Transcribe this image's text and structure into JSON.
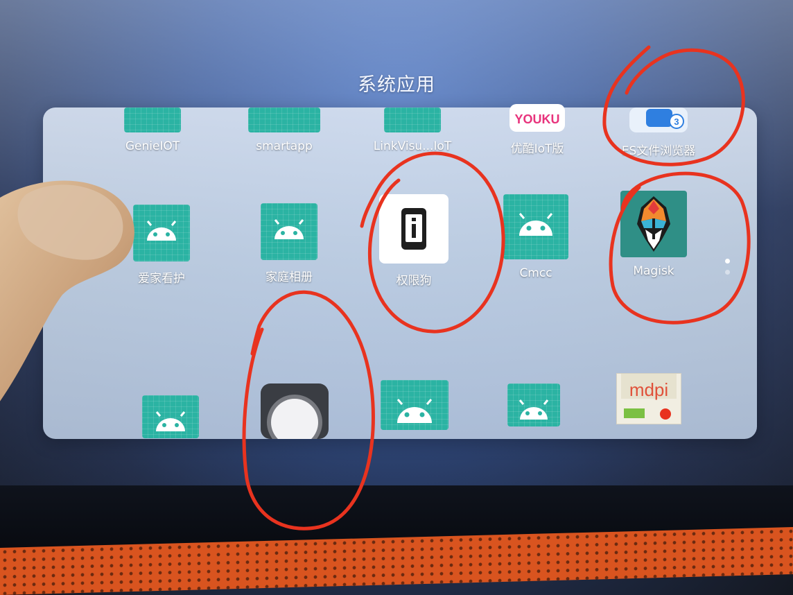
{
  "folder": {
    "title": "系统应用"
  },
  "apps": [
    {
      "label": "GenieIOT",
      "icon": "android-icon"
    },
    {
      "label": "smartapp",
      "icon": "android-icon"
    },
    {
      "label": "LinkVisu...IoT",
      "icon": "android-icon"
    },
    {
      "label": "优酷IoT版",
      "icon": "youku-icon",
      "icon_text": "YOUKU"
    },
    {
      "label": "ES文件浏览器",
      "icon": "es-file-explorer-icon",
      "icon_text": "3"
    },
    {
      "label": "爱家看护",
      "icon": "android-icon"
    },
    {
      "label": "家庭相册",
      "icon": "android-icon"
    },
    {
      "label": "权限狗",
      "icon": "info-phone-icon"
    },
    {
      "label": "Cmcc",
      "icon": "android-icon"
    },
    {
      "label": "Magisk",
      "icon": "magisk-icon"
    },
    {
      "label": "",
      "icon": "android-icon"
    },
    {
      "label": "",
      "icon": "assistive-touch-icon"
    },
    {
      "label": "",
      "icon": "android-icon"
    },
    {
      "label": "",
      "icon": "android-icon"
    },
    {
      "label": "",
      "icon": "mdpi-test-icon",
      "icon_text": "mdpi"
    }
  ],
  "pager": {
    "pages": 2,
    "current": 1
  },
  "colors": {
    "annotation": "#e8331f",
    "android_tile": "#2bb3a3",
    "device_speaker": "#d9541f"
  }
}
